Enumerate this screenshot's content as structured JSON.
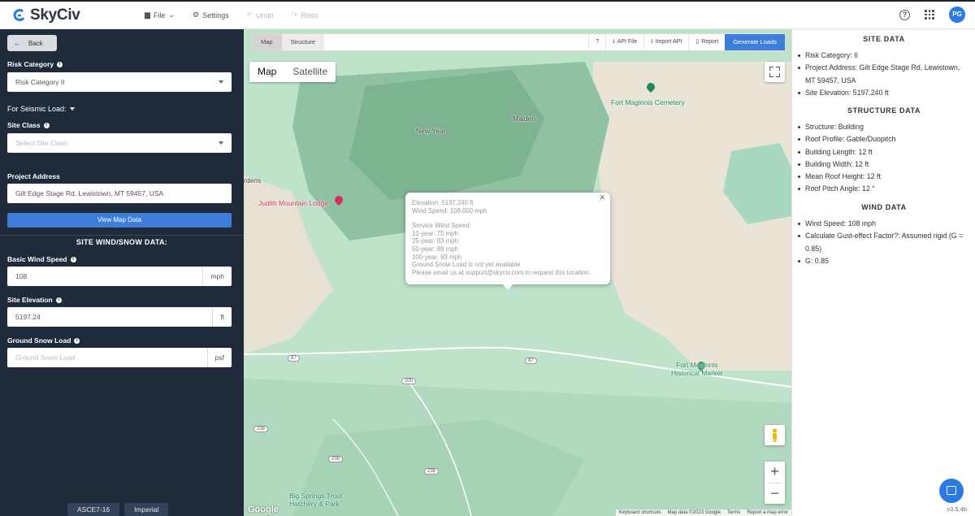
{
  "app": {
    "brand": "SkyCiv",
    "menu": {
      "file": "File",
      "settings": "Settings",
      "undo": "Undo",
      "redo": "Redo"
    },
    "help_glyph": "?",
    "user_initials": "PG"
  },
  "sidebar": {
    "back_label": "Back",
    "risk_category_label": "Risk Category",
    "risk_category_value": "Risk Category II",
    "seismic_label": "For Seismic Load:",
    "site_class_label": "Site Class",
    "site_class_placeholder": "Select Site Class",
    "project_address_label": "Project Address",
    "project_address_value": "Gilt Edge Stage Rd, Lewistown, MT 59457, USA",
    "view_map_button": "View Map Data",
    "site_heading": "SITE WIND/SNOW DATA:",
    "basic_wind_label": "Basic Wind Speed",
    "basic_wind_value": "108",
    "basic_wind_unit": "mph",
    "site_elevation_label": "Site Elevation",
    "site_elevation_value": "5197.24",
    "site_elevation_unit": "ft",
    "ground_snow_label": "Ground Snow Load",
    "ground_snow_placeholder": "Ground Snow Load",
    "ground_snow_unit": "psf",
    "footer_tabs": [
      "ASCE7-16",
      "Imperial"
    ]
  },
  "map_toolbar": {
    "tab_map": "Map",
    "tab_structure": "Structure",
    "help": "?",
    "api_file": "API File",
    "import_api": "Import API",
    "report": "Report",
    "generate": "Generate Loads"
  },
  "map": {
    "type_map": "Map",
    "type_satellite": "Satellite",
    "labels": {
      "fort_cemetery": "Fort Maginnis Cemetery",
      "maiden": "Maiden",
      "new_year": "New Year",
      "gardens": "rdens",
      "judith_lodge": "Judith Mountain Lodge",
      "fort_marker": "Fort Maginnis\nHistorical Marker",
      "big_springs": "Big Springs Trout\nHatchery & Park",
      "hwy_87a": "87",
      "hwy_87b": "87",
      "hwy_200": "200",
      "hwy_238a": "238",
      "hwy_238b": "238",
      "hwy_238c": "238"
    },
    "attribution": [
      "Keyboard shortcuts",
      "Map data ©2023 Google",
      "Terms",
      "Report a map error"
    ],
    "google": "Google",
    "popup": {
      "elevation": "Elevation: 5197.240 ft",
      "wind_speed": "Wind Speed: 108.000 mph",
      "service_heading": "Service Wind Speed:",
      "y10": "10-year: 75 mph",
      "y25": "25-year: 83 mph",
      "y50": "50-year: 88 mph",
      "y100": "100-year: 93 mph",
      "snow_note": "Ground Snow Load is not yet available",
      "email_note": "Please email us at support@skyciv.com to request this location."
    }
  },
  "right_panel": {
    "site_heading": "SITE DATA",
    "site_items": [
      "Risk Category: II",
      "Project Address: Gilt Edge Stage Rd, Lewistown, MT 59457, USA",
      "Site Elevation: 5197.240 ft"
    ],
    "structure_heading": "STRUCTURE DATA",
    "structure_items": [
      "Structure: Building",
      "Roof Profile: Gable/Duopitch",
      "Building Length: 12 ft",
      "Building Width: 12 ft",
      "Mean Roof Height: 12 ft",
      "Roof Pitch Angle: 12 °"
    ],
    "wind_heading": "WIND DATA",
    "wind_items": [
      "Wind Speed: 108 mph",
      "Calculate Gust-effect Factor?: Assumed rigid (G = 0.85)",
      "G: 0.85"
    ],
    "version": "v3.5.4b"
  }
}
